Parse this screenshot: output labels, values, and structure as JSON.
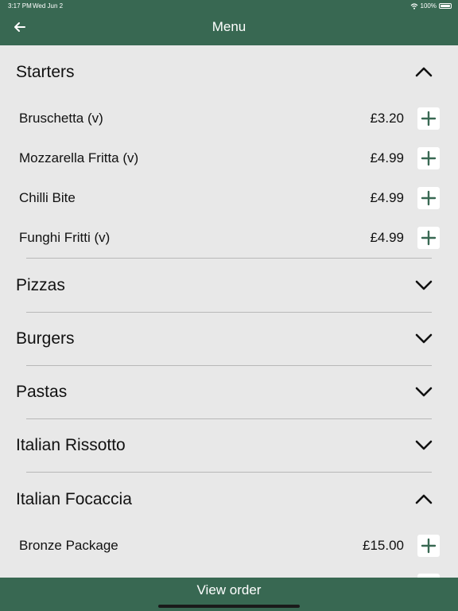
{
  "status_bar": {
    "time": "3:17 PM",
    "date": "Wed Jun 2",
    "battery": "100%"
  },
  "header": {
    "title": "Menu",
    "back_icon": "arrow-left-icon"
  },
  "colors": {
    "brand": "#386852",
    "background": "#e8e8e8",
    "button_bg": "#ffffff"
  },
  "sections": [
    {
      "title": "Starters",
      "expanded": true,
      "items": [
        {
          "name": "Bruschetta (v)",
          "price": "£3.20"
        },
        {
          "name": "Mozzarella Fritta (v)",
          "price": "£4.99"
        },
        {
          "name": "Chilli Bite",
          "price": "£4.99"
        },
        {
          "name": "Funghi Fritti (v)",
          "price": "£4.99"
        }
      ]
    },
    {
      "title": "Pizzas",
      "expanded": false
    },
    {
      "title": "Burgers",
      "expanded": false
    },
    {
      "title": "Pastas",
      "expanded": false
    },
    {
      "title": "Italian Rissotto",
      "expanded": false
    },
    {
      "title": "Italian Focaccia",
      "expanded": true,
      "items": [
        {
          "name": "Bronze Package",
          "price": "£15.00"
        }
      ]
    }
  ],
  "footer": {
    "label": "View order"
  }
}
